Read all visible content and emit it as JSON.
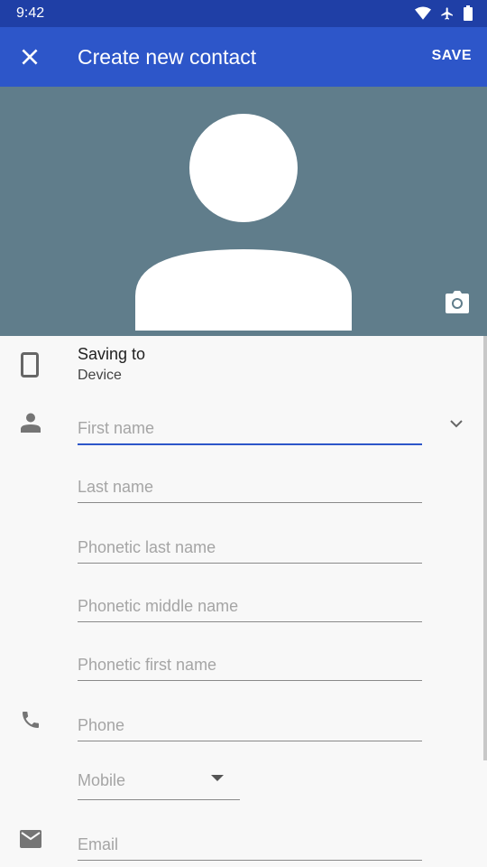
{
  "status_bar": {
    "time": "9:42",
    "icons": [
      "wifi-icon",
      "airplane-icon",
      "battery-icon"
    ]
  },
  "app_bar": {
    "title": "Create new contact",
    "save_label": "SAVE",
    "close_icon": "close-icon"
  },
  "photo": {
    "camera_icon": "camera-icon"
  },
  "saving_to": {
    "label": "Saving to",
    "value": "Device"
  },
  "fields": {
    "first_name": {
      "placeholder": "First name",
      "value": ""
    },
    "last_name": {
      "placeholder": "Last name",
      "value": ""
    },
    "phonetic_last": {
      "placeholder": "Phonetic last name",
      "value": ""
    },
    "phonetic_middle": {
      "placeholder": "Phonetic middle name",
      "value": ""
    },
    "phonetic_first": {
      "placeholder": "Phonetic first name",
      "value": ""
    },
    "phone": {
      "placeholder": "Phone",
      "value": ""
    },
    "phone_type": {
      "value": "Mobile"
    },
    "email": {
      "placeholder": "Email",
      "value": ""
    }
  },
  "colors": {
    "status_bar": "#1f3fa6",
    "app_bar": "#2d56c9",
    "photo_bg": "#607d8b",
    "accent": "#2d56c9"
  }
}
